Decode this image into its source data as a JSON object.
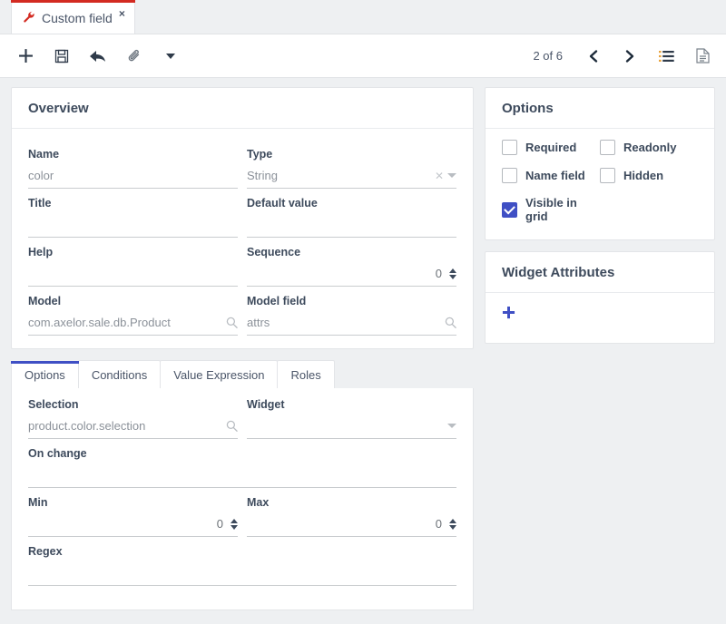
{
  "window": {
    "tab": {
      "title": "Custom field",
      "icon": "wrench-icon",
      "close": "×",
      "accent": "#d32a21"
    }
  },
  "toolbar": {
    "new_label": "+",
    "icons": [
      "plus-icon",
      "save-icon",
      "back-icon",
      "attachment-icon",
      "more-caret-icon"
    ],
    "pager": "2 of 6",
    "prev": "‹",
    "next": "›",
    "list_view": "list-icon",
    "form_view": "document-icon"
  },
  "overview": {
    "title": "Overview",
    "fields": {
      "name": {
        "label": "Name",
        "value": "color"
      },
      "type": {
        "label": "Type",
        "value": "String"
      },
      "title": {
        "label": "Title",
        "value": ""
      },
      "default_value": {
        "label": "Default value",
        "value": ""
      },
      "help": {
        "label": "Help",
        "value": ""
      },
      "sequence": {
        "label": "Sequence",
        "value": "0"
      },
      "model": {
        "label": "Model",
        "value": "com.axelor.sale.db.Product"
      },
      "model_field": {
        "label": "Model field",
        "value": "attrs"
      }
    }
  },
  "options_panel": {
    "title": "Options",
    "checkboxes": [
      {
        "label": "Required",
        "checked": false
      },
      {
        "label": "Readonly",
        "checked": false
      },
      {
        "label": "Name field",
        "checked": false
      },
      {
        "label": "Hidden",
        "checked": false
      },
      {
        "label": "Visible in grid",
        "checked": true
      }
    ],
    "checked_color": "#3f4fc4"
  },
  "widget_attributes": {
    "title": "Widget Attributes",
    "add_label": "➕",
    "add_symbol": "+"
  },
  "detail_tabs": {
    "items": [
      {
        "label": "Options",
        "active": true
      },
      {
        "label": "Conditions",
        "active": false
      },
      {
        "label": "Value Expression",
        "active": false
      },
      {
        "label": "Roles",
        "active": false
      }
    ],
    "active_color": "#3f4fc4",
    "fields": {
      "selection": {
        "label": "Selection",
        "value": "product.color.selection"
      },
      "widget": {
        "label": "Widget",
        "value": ""
      },
      "on_change": {
        "label": "On change",
        "value": ""
      },
      "min": {
        "label": "Min",
        "value": "0"
      },
      "max": {
        "label": "Max",
        "value": "0"
      },
      "regex": {
        "label": "Regex",
        "value": ""
      }
    }
  }
}
